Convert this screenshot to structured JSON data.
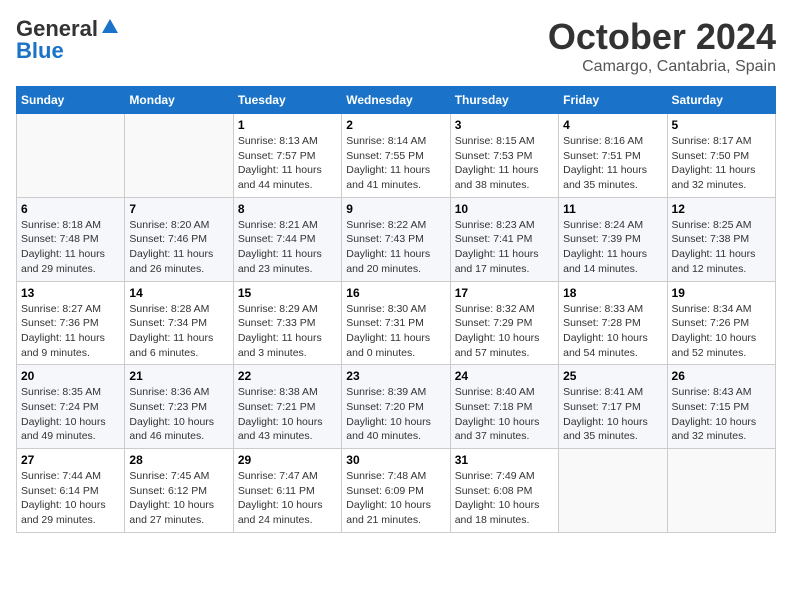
{
  "logo": {
    "line1": "General",
    "line2": "Blue"
  },
  "title": "October 2024",
  "location": "Camargo, Cantabria, Spain",
  "headers": [
    "Sunday",
    "Monday",
    "Tuesday",
    "Wednesday",
    "Thursday",
    "Friday",
    "Saturday"
  ],
  "weeks": [
    [
      {
        "day": "",
        "info": ""
      },
      {
        "day": "",
        "info": ""
      },
      {
        "day": "1",
        "info": "Sunrise: 8:13 AM\nSunset: 7:57 PM\nDaylight: 11 hours\nand 44 minutes."
      },
      {
        "day": "2",
        "info": "Sunrise: 8:14 AM\nSunset: 7:55 PM\nDaylight: 11 hours\nand 41 minutes."
      },
      {
        "day": "3",
        "info": "Sunrise: 8:15 AM\nSunset: 7:53 PM\nDaylight: 11 hours\nand 38 minutes."
      },
      {
        "day": "4",
        "info": "Sunrise: 8:16 AM\nSunset: 7:51 PM\nDaylight: 11 hours\nand 35 minutes."
      },
      {
        "day": "5",
        "info": "Sunrise: 8:17 AM\nSunset: 7:50 PM\nDaylight: 11 hours\nand 32 minutes."
      }
    ],
    [
      {
        "day": "6",
        "info": "Sunrise: 8:18 AM\nSunset: 7:48 PM\nDaylight: 11 hours\nand 29 minutes."
      },
      {
        "day": "7",
        "info": "Sunrise: 8:20 AM\nSunset: 7:46 PM\nDaylight: 11 hours\nand 26 minutes."
      },
      {
        "day": "8",
        "info": "Sunrise: 8:21 AM\nSunset: 7:44 PM\nDaylight: 11 hours\nand 23 minutes."
      },
      {
        "day": "9",
        "info": "Sunrise: 8:22 AM\nSunset: 7:43 PM\nDaylight: 11 hours\nand 20 minutes."
      },
      {
        "day": "10",
        "info": "Sunrise: 8:23 AM\nSunset: 7:41 PM\nDaylight: 11 hours\nand 17 minutes."
      },
      {
        "day": "11",
        "info": "Sunrise: 8:24 AM\nSunset: 7:39 PM\nDaylight: 11 hours\nand 14 minutes."
      },
      {
        "day": "12",
        "info": "Sunrise: 8:25 AM\nSunset: 7:38 PM\nDaylight: 11 hours\nand 12 minutes."
      }
    ],
    [
      {
        "day": "13",
        "info": "Sunrise: 8:27 AM\nSunset: 7:36 PM\nDaylight: 11 hours\nand 9 minutes."
      },
      {
        "day": "14",
        "info": "Sunrise: 8:28 AM\nSunset: 7:34 PM\nDaylight: 11 hours\nand 6 minutes."
      },
      {
        "day": "15",
        "info": "Sunrise: 8:29 AM\nSunset: 7:33 PM\nDaylight: 11 hours\nand 3 minutes."
      },
      {
        "day": "16",
        "info": "Sunrise: 8:30 AM\nSunset: 7:31 PM\nDaylight: 11 hours\nand 0 minutes."
      },
      {
        "day": "17",
        "info": "Sunrise: 8:32 AM\nSunset: 7:29 PM\nDaylight: 10 hours\nand 57 minutes."
      },
      {
        "day": "18",
        "info": "Sunrise: 8:33 AM\nSunset: 7:28 PM\nDaylight: 10 hours\nand 54 minutes."
      },
      {
        "day": "19",
        "info": "Sunrise: 8:34 AM\nSunset: 7:26 PM\nDaylight: 10 hours\nand 52 minutes."
      }
    ],
    [
      {
        "day": "20",
        "info": "Sunrise: 8:35 AM\nSunset: 7:24 PM\nDaylight: 10 hours\nand 49 minutes."
      },
      {
        "day": "21",
        "info": "Sunrise: 8:36 AM\nSunset: 7:23 PM\nDaylight: 10 hours\nand 46 minutes."
      },
      {
        "day": "22",
        "info": "Sunrise: 8:38 AM\nSunset: 7:21 PM\nDaylight: 10 hours\nand 43 minutes."
      },
      {
        "day": "23",
        "info": "Sunrise: 8:39 AM\nSunset: 7:20 PM\nDaylight: 10 hours\nand 40 minutes."
      },
      {
        "day": "24",
        "info": "Sunrise: 8:40 AM\nSunset: 7:18 PM\nDaylight: 10 hours\nand 37 minutes."
      },
      {
        "day": "25",
        "info": "Sunrise: 8:41 AM\nSunset: 7:17 PM\nDaylight: 10 hours\nand 35 minutes."
      },
      {
        "day": "26",
        "info": "Sunrise: 8:43 AM\nSunset: 7:15 PM\nDaylight: 10 hours\nand 32 minutes."
      }
    ],
    [
      {
        "day": "27",
        "info": "Sunrise: 7:44 AM\nSunset: 6:14 PM\nDaylight: 10 hours\nand 29 minutes."
      },
      {
        "day": "28",
        "info": "Sunrise: 7:45 AM\nSunset: 6:12 PM\nDaylight: 10 hours\nand 27 minutes."
      },
      {
        "day": "29",
        "info": "Sunrise: 7:47 AM\nSunset: 6:11 PM\nDaylight: 10 hours\nand 24 minutes."
      },
      {
        "day": "30",
        "info": "Sunrise: 7:48 AM\nSunset: 6:09 PM\nDaylight: 10 hours\nand 21 minutes."
      },
      {
        "day": "31",
        "info": "Sunrise: 7:49 AM\nSunset: 6:08 PM\nDaylight: 10 hours\nand 18 minutes."
      },
      {
        "day": "",
        "info": ""
      },
      {
        "day": "",
        "info": ""
      }
    ]
  ]
}
